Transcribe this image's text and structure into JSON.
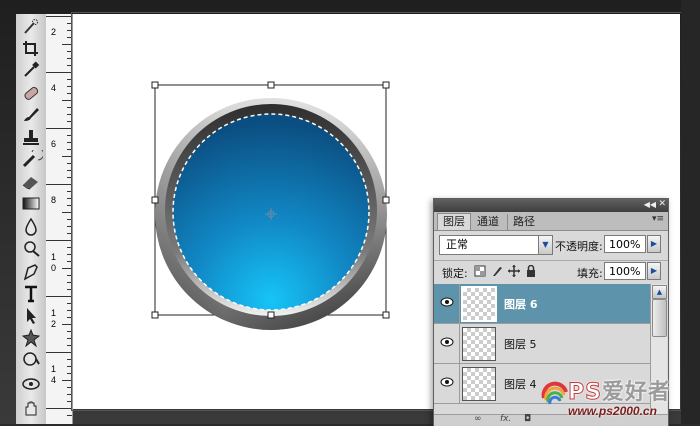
{
  "toolbar": {
    "tools": [
      "quick-selection-tool-icon",
      "crop-tool-icon",
      "eyedropper-tool-icon",
      "healing-brush-tool-icon",
      "brush-tool-icon",
      "clone-stamp-tool-icon",
      "history-brush-tool-icon",
      "eraser-tool-icon",
      "gradient-tool-icon",
      "blur-tool-icon",
      "dodge-tool-icon",
      "pen-tool-icon",
      "type-tool-icon",
      "path-selection-tool-icon",
      "custom-shape-tool-icon",
      "3d-rotate-tool-icon"
    ]
  },
  "ruler": {
    "labels": [
      "2",
      "4",
      "6",
      "8",
      "1\n0",
      "1\n2",
      "1\n4"
    ]
  },
  "canvas": {
    "circle_colors": {
      "ring_light": "#e6e6e6",
      "ring_dark": "#404040",
      "blue_top": "#0d5a8f",
      "blue_bottom": "#13b6f0"
    }
  },
  "layers_panel": {
    "tabs": [
      "图层",
      "通道",
      "路径"
    ],
    "active_tab": "图层",
    "blend_mode": "正常",
    "opacity_label": "不透明度:",
    "opacity_value": "100%",
    "lock_label": "锁定:",
    "fill_label": "填充:",
    "fill_value": "100%",
    "layers": [
      {
        "name": "图层 6",
        "selected": true
      },
      {
        "name": "图层 5",
        "selected": false
      },
      {
        "name": "图层 4",
        "selected": false
      }
    ],
    "bottom_icons": [
      "link-icon",
      "fx-icon",
      "mask-icon"
    ],
    "bottom_fx": "fx."
  },
  "watermark": {
    "logo_text": "PS爱好者",
    "logo_ps": "PS",
    "logo_cn": "爱好者",
    "url": "www.ps2000.cn"
  },
  "colors": {
    "selected_layer": "#5e93ac",
    "panel_bg": "#d9d9d9",
    "toolbar_bg": "#dcdcdc"
  }
}
